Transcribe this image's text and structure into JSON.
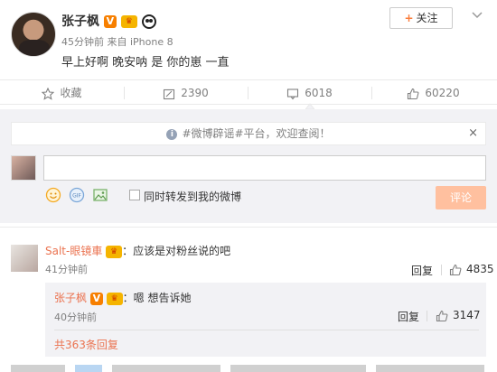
{
  "post": {
    "author": "张子枫",
    "meta": "45分钟前 来自 iPhone 8",
    "text": "早上好啊 晚安呐 是 你的崽 一直",
    "follow_label": "关注",
    "verified_icon": "verified-v-icon",
    "vip_icon": "vip-crown-icon",
    "emoji_icon": "panda-icon"
  },
  "actions": {
    "favorite_label": "收藏",
    "repost_count": "2390",
    "comment_count": "6018",
    "like_count": "60220"
  },
  "comment_panel": {
    "notice": "#微博辟谣#平台，欢迎查阅！",
    "input_value": "",
    "also_repost_label": "同时转发到我的微博",
    "submit_label": "评论"
  },
  "comments": [
    {
      "user": "Salt-眼镜車",
      "text": "：应该是对粉丝说的吧",
      "time": "41分钟前",
      "reply_label": "回复",
      "likes": "4835",
      "sub_reply": {
        "user": "张子枫",
        "text": "：嗯 想告诉她",
        "time": "40分钟前",
        "reply_label": "回复",
        "likes": "3147",
        "total_replies": "共363条回复"
      }
    }
  ],
  "colors": {
    "accent": "#eb7350",
    "submit_disabled": "#ffc09f",
    "panel_bg": "#f2f2f5",
    "muted": "#808080"
  }
}
